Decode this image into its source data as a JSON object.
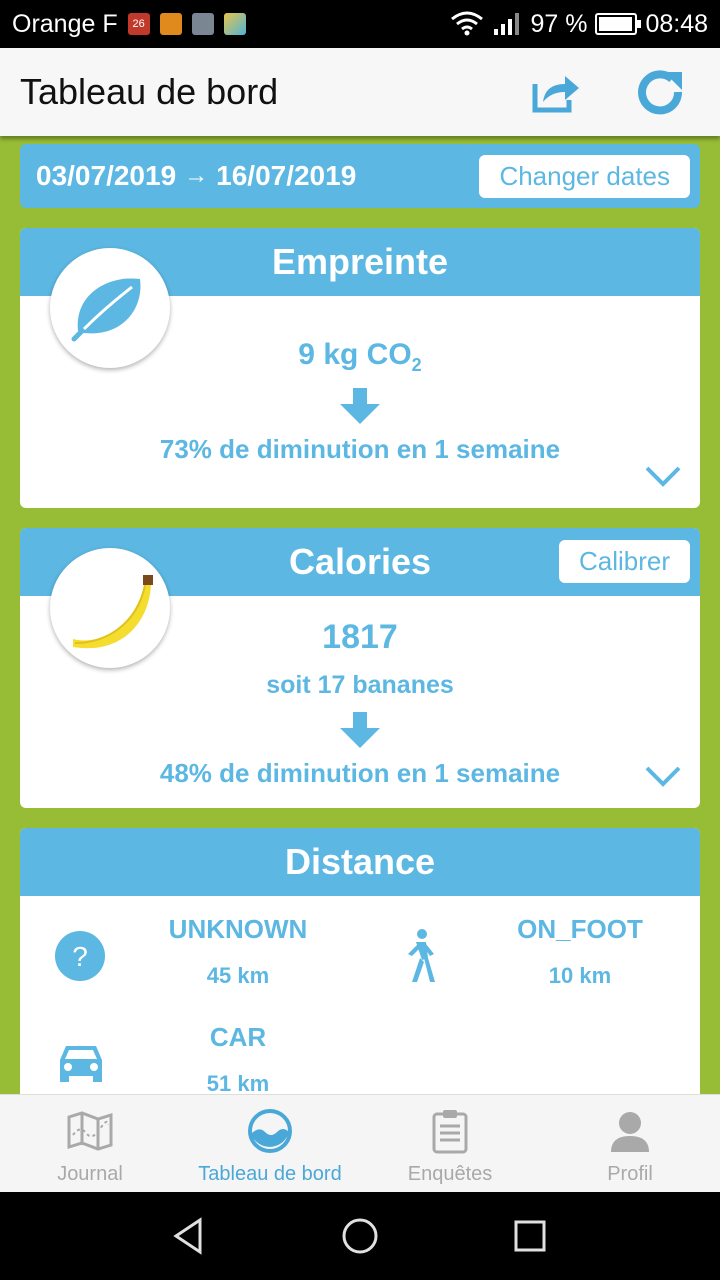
{
  "status_bar": {
    "carrier": "Orange F",
    "calendar_day": "26",
    "battery_percent": "97 %",
    "battery_level": 0.97,
    "time": "08:48"
  },
  "app_bar": {
    "title": "Tableau de bord",
    "actions": [
      "share-icon",
      "refresh-icon"
    ]
  },
  "date_range": {
    "start": "03/07/2019",
    "arrow": "→",
    "end": "16/07/2019",
    "change_label": "Changer dates"
  },
  "empreinte": {
    "title": "Empreinte",
    "value": "9 kg CO",
    "value_sub": "2",
    "change_text": "73% de diminution en 1 semaine",
    "icon": "leaf-icon"
  },
  "calories": {
    "title": "Calories",
    "calibrate_label": "Calibrer",
    "value": "1817",
    "equivalent": "soit 17 bananes",
    "change_text": "48% de diminution en 1 semaine",
    "icon": "banana-icon"
  },
  "distance": {
    "title": "Distance",
    "modes": [
      {
        "name": "UNKNOWN",
        "value": "45 km",
        "icon": "question-icon"
      },
      {
        "name": "ON_FOOT",
        "value": "10 km",
        "icon": "walking-icon"
      },
      {
        "name": "CAR",
        "value": "51 km",
        "icon": "car-icon"
      }
    ]
  },
  "tabs": [
    {
      "label": "Journal",
      "icon": "map-icon",
      "active": false
    },
    {
      "label": "Tableau de bord",
      "icon": "dashboard-icon",
      "active": true
    },
    {
      "label": "Enquêtes",
      "icon": "clipboard-icon",
      "active": false
    },
    {
      "label": "Profil",
      "icon": "user-icon",
      "active": false
    }
  ],
  "colors": {
    "accent": "#5cb7e2",
    "background": "#97bd36",
    "inactive_tab": "#a9a9a9"
  }
}
